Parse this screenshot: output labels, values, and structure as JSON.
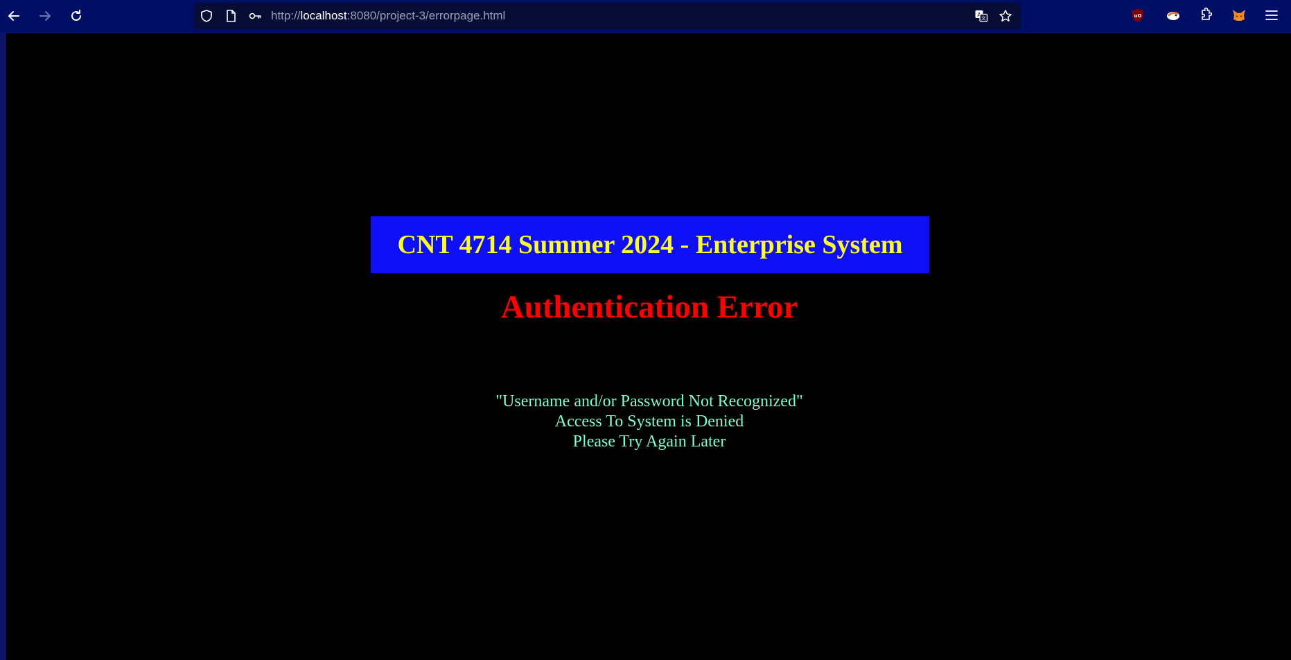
{
  "browser": {
    "url_prefix": "http://",
    "url_host": "localhost",
    "url_rest": ":8080/project-3/errorpage.html",
    "icons": {
      "back": "back-arrow-icon",
      "forward": "forward-arrow-icon",
      "reload": "reload-icon",
      "tracking_protection": "shield-icon",
      "page_info": "page-icon",
      "passwords": "key-icon",
      "translate": "translate-icon",
      "bookmark": "star-icon",
      "ublock": "ublock-icon",
      "extension_fox": "fox-icon",
      "extensions": "puzzle-icon",
      "metamask": "metamask-icon",
      "menu": "hamburger-menu-icon"
    }
  },
  "page": {
    "banner_title": "CNT 4714 Summer 2024 - Enterprise System",
    "error_title": "Authentication Error",
    "message_lines": [
      "\"Username and/or Password Not Recognized\"",
      "Access To System is Denied",
      "Please Try Again Later"
    ]
  },
  "colors": {
    "page_background": "#000000",
    "banner_background": "#0f0ff5",
    "banner_text": "#ffff22",
    "error_text": "#ff0000",
    "message_text": "#7dffcf",
    "toolbar": "#000f66"
  }
}
